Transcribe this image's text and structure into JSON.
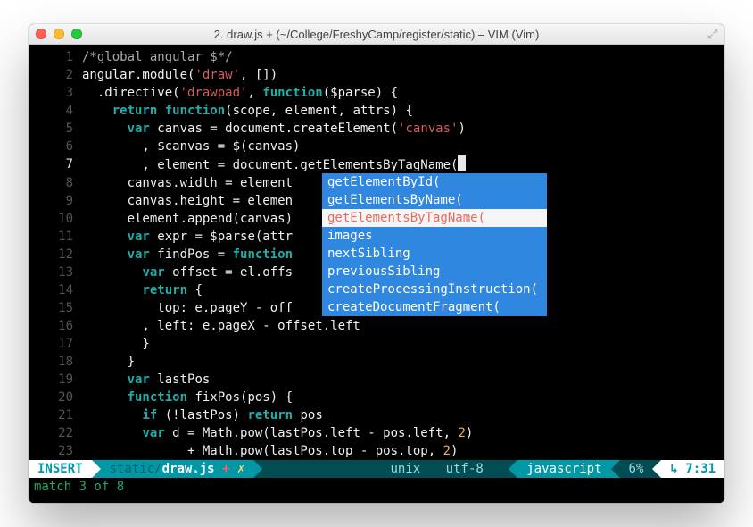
{
  "window": {
    "title": "2. draw.js + (~/College/FreshyCamp/register/static) – VIM (Vim)"
  },
  "gutter": [
    "1",
    "2",
    "3",
    "4",
    "5",
    "6",
    "7",
    "8",
    "9",
    "10",
    "11",
    "12",
    "13",
    "14",
    "15",
    "16",
    "17",
    "18",
    "19",
    "20",
    "21",
    "22",
    "23"
  ],
  "code": {
    "l1_comment": "/*global angular $*/",
    "l2_a": "angular.module(",
    "l2_s": "'draw'",
    "l2_b": ", [])",
    "l3_a": "  .directive(",
    "l3_s": "'drawpad'",
    "l3_b": ", ",
    "l3_fn": "function",
    "l3_c": "($parse) {",
    "l4_a": "    ",
    "l4_ret": "return",
    "l4_b": " ",
    "l4_fn": "function",
    "l4_c": "(scope, element, attrs) {",
    "l5_a": "      ",
    "l5_var": "var",
    "l5_b": " canvas = document.createElement(",
    "l5_s": "'canvas'",
    "l5_c": ")",
    "l6": "        , $canvas = $(canvas)",
    "l7": "        , element = document.getElementsByTagName(",
    "l8": "      canvas.width = element",
    "l9": "      canvas.height = elemen",
    "l10": "      element.append(canvas)",
    "l11_a": "      ",
    "l11_var": "var",
    "l11_b": " expr = $parse(attr",
    "l12_a": "      ",
    "l12_var": "var",
    "l12_b": " findPos = ",
    "l12_fn": "function",
    "l13_a": "        ",
    "l13_var": "var",
    "l13_b": " offset = el.offs",
    "l14_a": "        ",
    "l14_ret": "return",
    "l14_b": " {",
    "l15": "          top: e.pageY - off",
    "l16": "        , left: e.pageX - offset.left",
    "l17": "        }",
    "l18": "      }",
    "l19_a": "      ",
    "l19_var": "var",
    "l19_b": " lastPos",
    "l20_a": "      ",
    "l20_fn": "function",
    "l20_b": " fixPos(pos) {",
    "l21_a": "        ",
    "l21_if": "if",
    "l21_b": " (!lastPos) ",
    "l21_ret": "return",
    "l21_c": " pos",
    "l22_a": "        ",
    "l22_var": "var",
    "l22_b": " d = Math.pow(lastPos.left - pos.left, ",
    "l22_n": "2",
    "l22_c": ")",
    "l23_a": "              + Math.pow(lastPos.top - pos.top, ",
    "l23_n": "2",
    "l23_b": ")"
  },
  "completion": {
    "items": [
      "getElementById(",
      "getElementsByName(",
      "getElementsByTagName(",
      "images",
      "nextSibling",
      "previousSibling",
      "createProcessingInstruction(",
      "createDocumentFragment("
    ],
    "selected_index": 2
  },
  "status": {
    "mode": " INSERT ",
    "file_dir": "static/",
    "file_name": "draw.js",
    "file_mod": " +",
    "fileformat": "unix",
    "encoding": "utf-8",
    "filetype": "javascript",
    "percent": "6%",
    "col_sym": "↳",
    "time": "7:31"
  },
  "message": "match 3 of 8"
}
